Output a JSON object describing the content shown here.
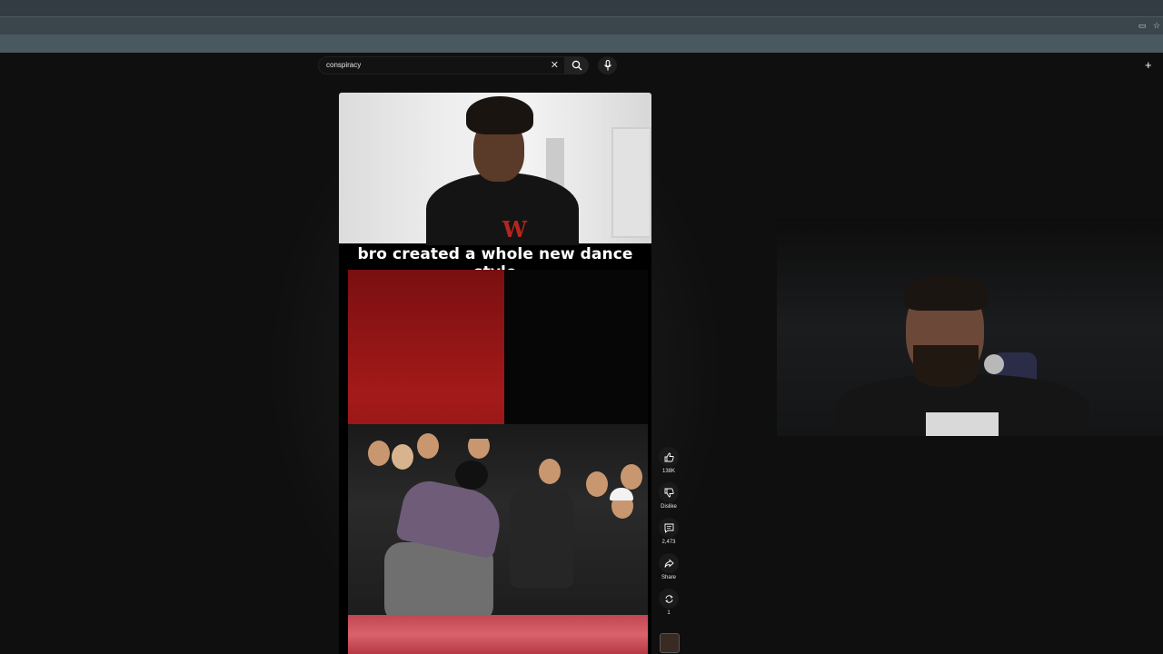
{
  "search": {
    "query": "conspiracy"
  },
  "short": {
    "caption": "bro created a whole new dance style"
  },
  "actions": {
    "like_count": "138K",
    "dislike_label": "Dislike",
    "comment_count": "2,473",
    "share_label": "Share",
    "remix_count": "1"
  },
  "icons": {
    "clear": "close-icon",
    "search": "search-icon",
    "mic": "microphone-icon",
    "like": "thumbs-up-icon",
    "dislike": "thumbs-down-icon",
    "comment": "comment-icon",
    "share": "share-icon",
    "remix": "remix-icon",
    "create": "plus-icon"
  },
  "colors": {
    "background": "#0f0f0f",
    "caption": "#ffffff"
  }
}
